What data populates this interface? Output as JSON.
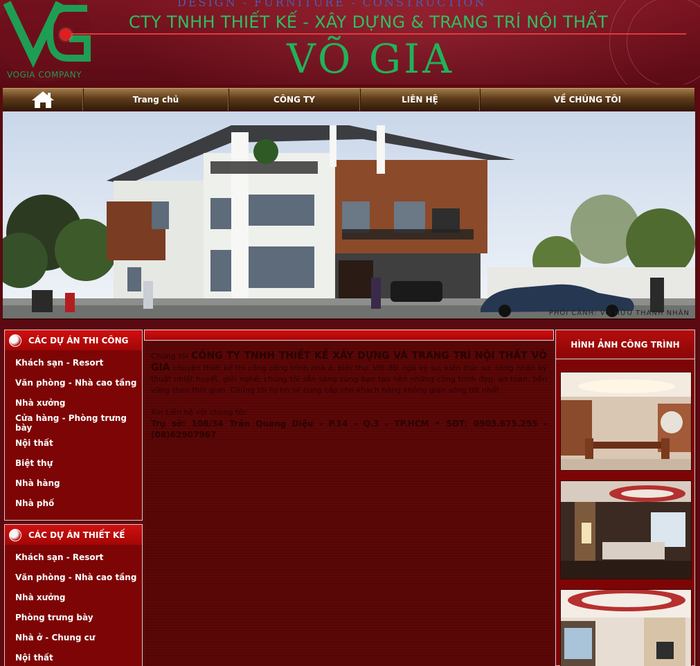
{
  "banner": {
    "tagline": "DESIGN - FURNITURE - CONSTRUCTION",
    "company_tag": "VOGIA COMPANY",
    "subtitle": "CTY TNHH THIẾT KẾ - XÂY DỰNG & TRANG TRÍ NỘI THẤT",
    "brand": "VÕ GIA"
  },
  "nav": {
    "home_icon": "home-icon",
    "items": [
      "Trang chủ",
      "CÔNG TY",
      "LIÊN HỆ",
      "VỀ CHÚNG TÔI"
    ]
  },
  "hero": {
    "caption": "PHỐI CẢNH: VÕ HỮU THANH NHÂN"
  },
  "sidebar": {
    "construction": {
      "title": "CÁC DỰ ÁN THI CÔNG",
      "items": [
        "Khách sạn - Resort",
        "Văn phòng - Nhà cao tầng",
        "Nhà xưởng",
        "Cửa hàng - Phòng trưng bày",
        "Nội thất",
        "Biệt thự",
        "Nhà hàng",
        "Nhà phố"
      ]
    },
    "design": {
      "title": "CÁC DỰ ÁN THIẾT KẾ",
      "items": [
        "Khách sạn - Resort",
        "Văn phòng - Nhà cao tầng",
        "Nhà xưởng",
        "Phòng trưng bày",
        "Nhà ở - Chung cư",
        "Nội thất"
      ]
    }
  },
  "main": {
    "intro_prefix": "Chúng tôi ",
    "intro_company": "CÔNG TY TNHH THIẾT KẾ XÂY DỰNG VÀ TRANG TRÍ NỘI THẤT VÕ GIA",
    "intro_body": " chuyên thiết kế thi công công trình nhà ở, biệt thự. Với đội ngũ kỹ sư, kiến trúc sư, công nhân kỹ thuật nhiệt huyết, giỏi nghề; chúng tôi sẵn sàng cùng bạn tạo nên những công trình đẹp, an toàn, bền vững theo thời gian. Chúng tôi tự tin sẽ cung cấp cho khách hàng không gian sống tốt nhất.",
    "contact_intro": "Xin Liên hệ với chúng tôi:",
    "contact_line": "Trụ sở: 108/34 Trần Quang Diệu - P.14 - Q.3 - TP.HCM   •  SĐT: 0903.675.255 - (08)62907967"
  },
  "right": {
    "title": "HÌNH ẢNH CÔNG TRÌNH"
  },
  "colors": {
    "page_bg": "#5a0a10",
    "banner_green": "#1fb35a",
    "accent_red": "#d01010",
    "panel_red": "#7e0505"
  }
}
